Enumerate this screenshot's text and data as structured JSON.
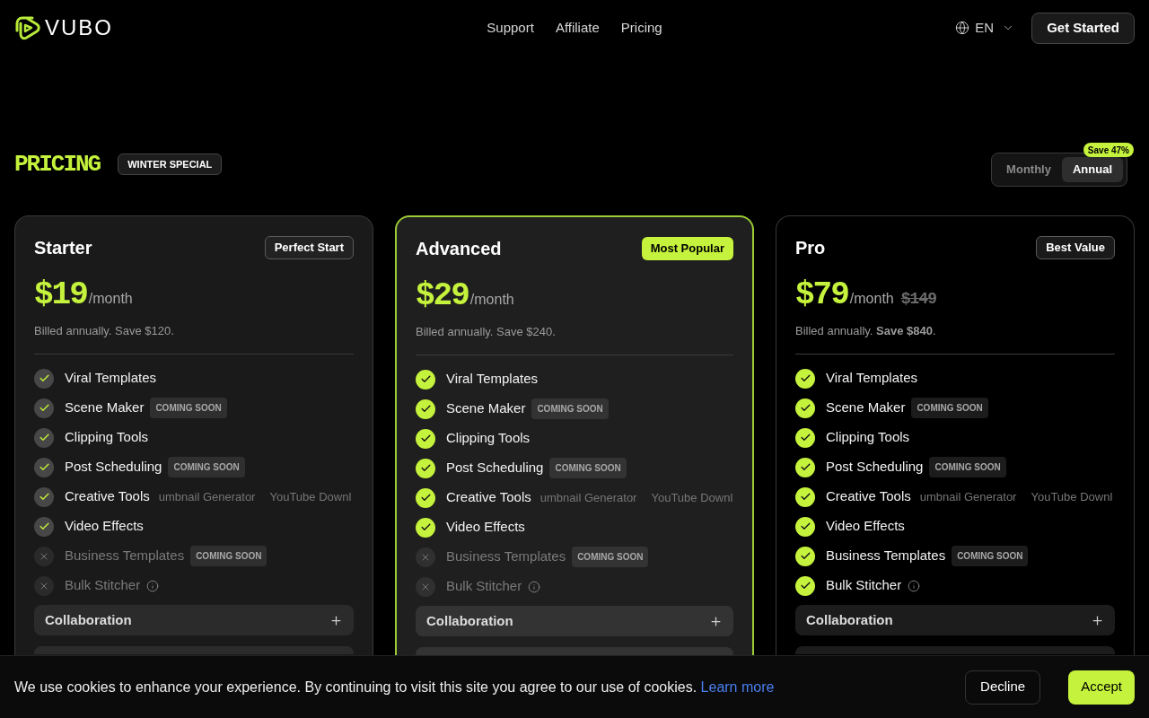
{
  "header": {
    "brand": "VUBO",
    "nav": [
      "Support",
      "Affiliate",
      "Pricing"
    ],
    "language": "EN",
    "cta": "Get Started"
  },
  "pricing": {
    "title": "PRICING",
    "promo_badge": "WINTER SPECIAL",
    "billing_toggle": {
      "options": [
        {
          "label": "Monthly",
          "selected": false
        },
        {
          "label": "Annual",
          "selected": true
        }
      ],
      "discount_badge": "Save 47%"
    },
    "plans": [
      {
        "name": "Starter",
        "kind": "standard",
        "badge": "Perfect Start",
        "price": "$19",
        "period": "/month",
        "billing": "Billed annually. Save $120.",
        "features": [
          {
            "label": "Viral Templates",
            "included": true
          },
          {
            "label": "Scene Maker",
            "included": true,
            "tag": "COMING SOON"
          },
          {
            "label": "Clipping Tools",
            "included": true
          },
          {
            "label": "Post Scheduling",
            "included": true,
            "tag": "COMING SOON"
          },
          {
            "label": "Creative Tools",
            "included": true,
            "sub_items": [
              "umbnail Generator",
              "YouTube Downl"
            ]
          },
          {
            "label": "Video Effects",
            "included": true
          },
          {
            "label": "Business Templates",
            "included": false,
            "tag": "COMING SOON"
          },
          {
            "label": "Bulk Stitcher",
            "included": false,
            "info": true
          }
        ],
        "accordions": [
          {
            "title": "Collaboration",
            "expanded": false
          }
        ]
      },
      {
        "name": "Advanced",
        "kind": "popular",
        "badge": "Most Popular",
        "price": "$29",
        "period": "/month",
        "billing": "Billed annually. Save $240.",
        "features": [
          {
            "label": "Viral Templates",
            "included": true
          },
          {
            "label": "Scene Maker",
            "included": true,
            "tag": "COMING SOON"
          },
          {
            "label": "Clipping Tools",
            "included": true
          },
          {
            "label": "Post Scheduling",
            "included": true,
            "tag": "COMING SOON"
          },
          {
            "label": "Creative Tools",
            "included": true,
            "sub_items": [
              "umbnail Generator",
              "YouTube Downl"
            ]
          },
          {
            "label": "Video Effects",
            "included": true
          },
          {
            "label": "Business Templates",
            "included": false,
            "tag": "COMING SOON"
          },
          {
            "label": "Bulk Stitcher",
            "included": false,
            "info": true
          }
        ],
        "accordions": [
          {
            "title": "Collaboration",
            "expanded": false
          }
        ]
      },
      {
        "name": "Pro",
        "kind": "premium",
        "badge": "Best Value",
        "price": "$79",
        "period": "/month",
        "original_price": "$149",
        "billing": "Billed annually. **Save $840**.",
        "features": [
          {
            "label": "Viral Templates",
            "included": true
          },
          {
            "label": "Scene Maker",
            "included": true,
            "tag": "COMING SOON"
          },
          {
            "label": "Clipping Tools",
            "included": true
          },
          {
            "label": "Post Scheduling",
            "included": true,
            "tag": "COMING SOON"
          },
          {
            "label": "Creative Tools",
            "included": true,
            "sub_items": [
              "umbnail Generator",
              "YouTube Downl"
            ]
          },
          {
            "label": "Video Effects",
            "included": true
          },
          {
            "label": "Business Templates",
            "included": true,
            "tag": "COMING SOON"
          },
          {
            "label": "Bulk Stitcher",
            "included": true,
            "info": true
          }
        ],
        "accordions": [
          {
            "title": "Collaboration",
            "expanded": false
          }
        ]
      }
    ]
  },
  "cookie_banner": {
    "message": "We use cookies to enhance your experience. By continuing to visit this site you agree to our use of cookies.",
    "link": "Learn more",
    "buttons": [
      {
        "label": "Decline",
        "kind": "secondary"
      },
      {
        "label": "Accept",
        "kind": "primary"
      }
    ]
  }
}
